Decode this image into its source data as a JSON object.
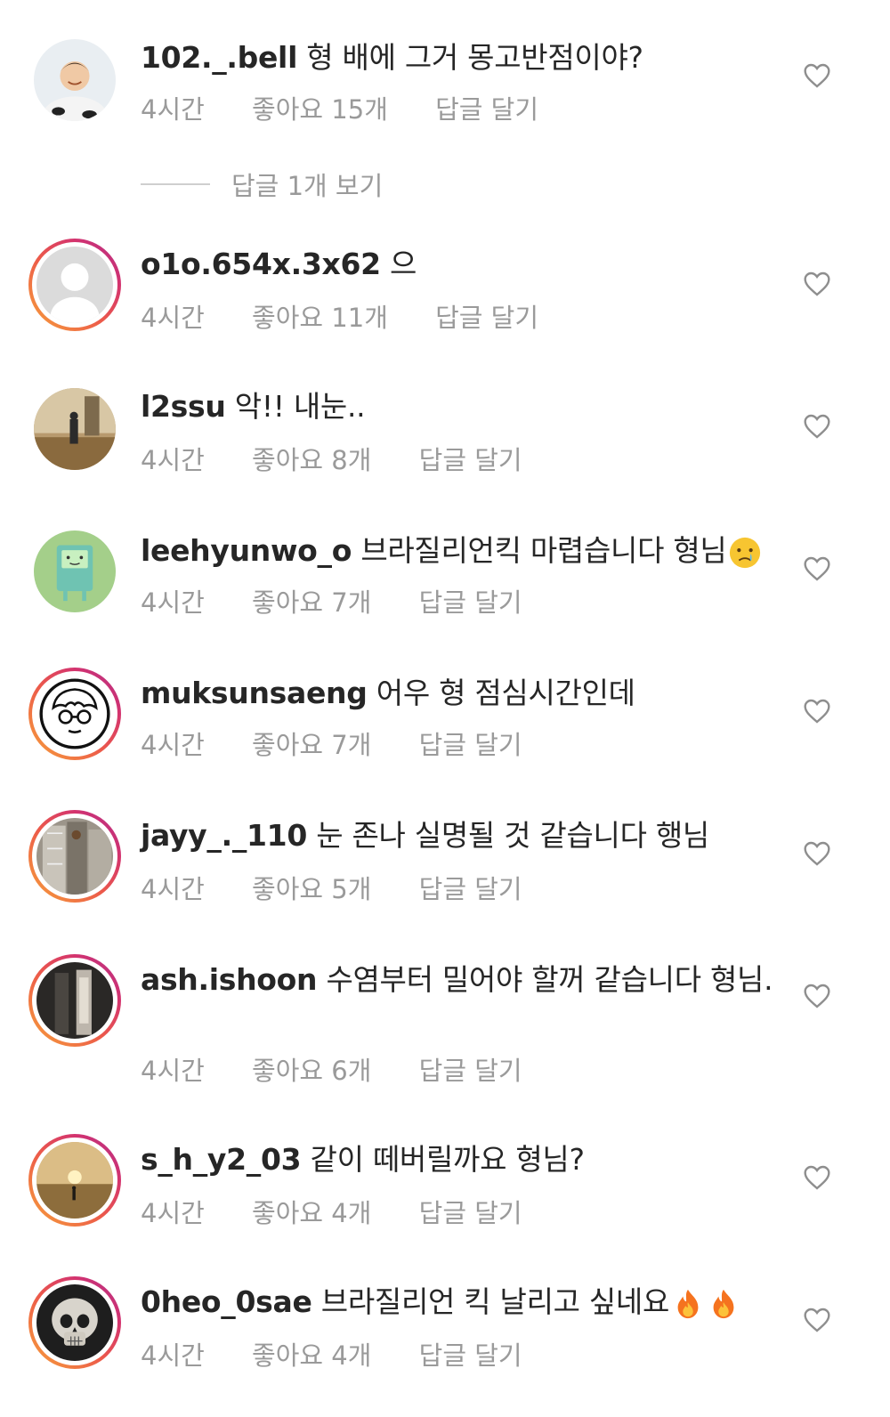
{
  "comments": [
    {
      "username": "102._.bell",
      "text": "형 배에 그거 몽고반점이야?",
      "time": "4시간",
      "likes": "좋아요 15개",
      "reply": "답글 달기",
      "avatar_icon": "person-photo-avatar",
      "has_story_ring": false
    },
    {
      "username": "o1o.654x.3x62",
      "text": "으",
      "time": "4시간",
      "likes": "좋아요 11개",
      "reply": "답글 달기",
      "avatar_icon": "default-user-avatar",
      "has_story_ring": true
    },
    {
      "username": "l2ssu",
      "text": "악!! 내눈..",
      "time": "4시간",
      "likes": "좋아요 8개",
      "reply": "답글 달기",
      "avatar_icon": "room-photo-avatar",
      "has_story_ring": false
    },
    {
      "username": "leehyunwo_o",
      "text": "브라질리언킥 마렵습니다 형님",
      "emoji": "crying-face-emoji",
      "time": "4시간",
      "likes": "좋아요 7개",
      "reply": "답글 달기",
      "avatar_icon": "bmo-character-avatar",
      "has_story_ring": false
    },
    {
      "username": "muksunsaeng",
      "text": "어우 형 점심시간인데",
      "time": "4시간",
      "likes": "좋아요 7개",
      "reply": "답글 달기",
      "avatar_icon": "cartoon-face-avatar",
      "has_story_ring": true
    },
    {
      "username": "jayy_._110",
      "text": "눈 존나 실명될 것 같습니다 행님",
      "time": "4시간",
      "likes": "좋아요 5개",
      "reply": "답글 달기",
      "avatar_icon": "clothes-photo-avatar",
      "has_story_ring": true
    },
    {
      "username": "ash.ishoon",
      "text": "수염부터 밀어야 할꺼 같습니다 형님.",
      "time": "4시간",
      "likes": "좋아요 6개",
      "reply": "답글 달기",
      "avatar_icon": "dark-photo-avatar",
      "has_story_ring": true
    },
    {
      "username": "s_h_y2_03",
      "text": "같이 떼버릴까요 형님?",
      "time": "4시간",
      "likes": "좋아요 4개",
      "reply": "답글 달기",
      "avatar_icon": "sunset-photo-avatar",
      "has_story_ring": true
    },
    {
      "username": "0heo_0sae",
      "text": "브라질리언 킥 날리고 싶네요",
      "emoji": "fire-emoji-x2",
      "time": "4시간",
      "likes": "좋아요 4개",
      "reply": "답글 달기",
      "avatar_icon": "skull-photo-avatar",
      "has_story_ring": true
    }
  ],
  "view_replies": "답글 1개 보기",
  "heart_icon": "heart-outline-icon",
  "colors": {
    "text": "#262626",
    "meta": "#9a9a9a",
    "ring_start": "#f7a23a",
    "ring_end": "#b12f8a"
  }
}
